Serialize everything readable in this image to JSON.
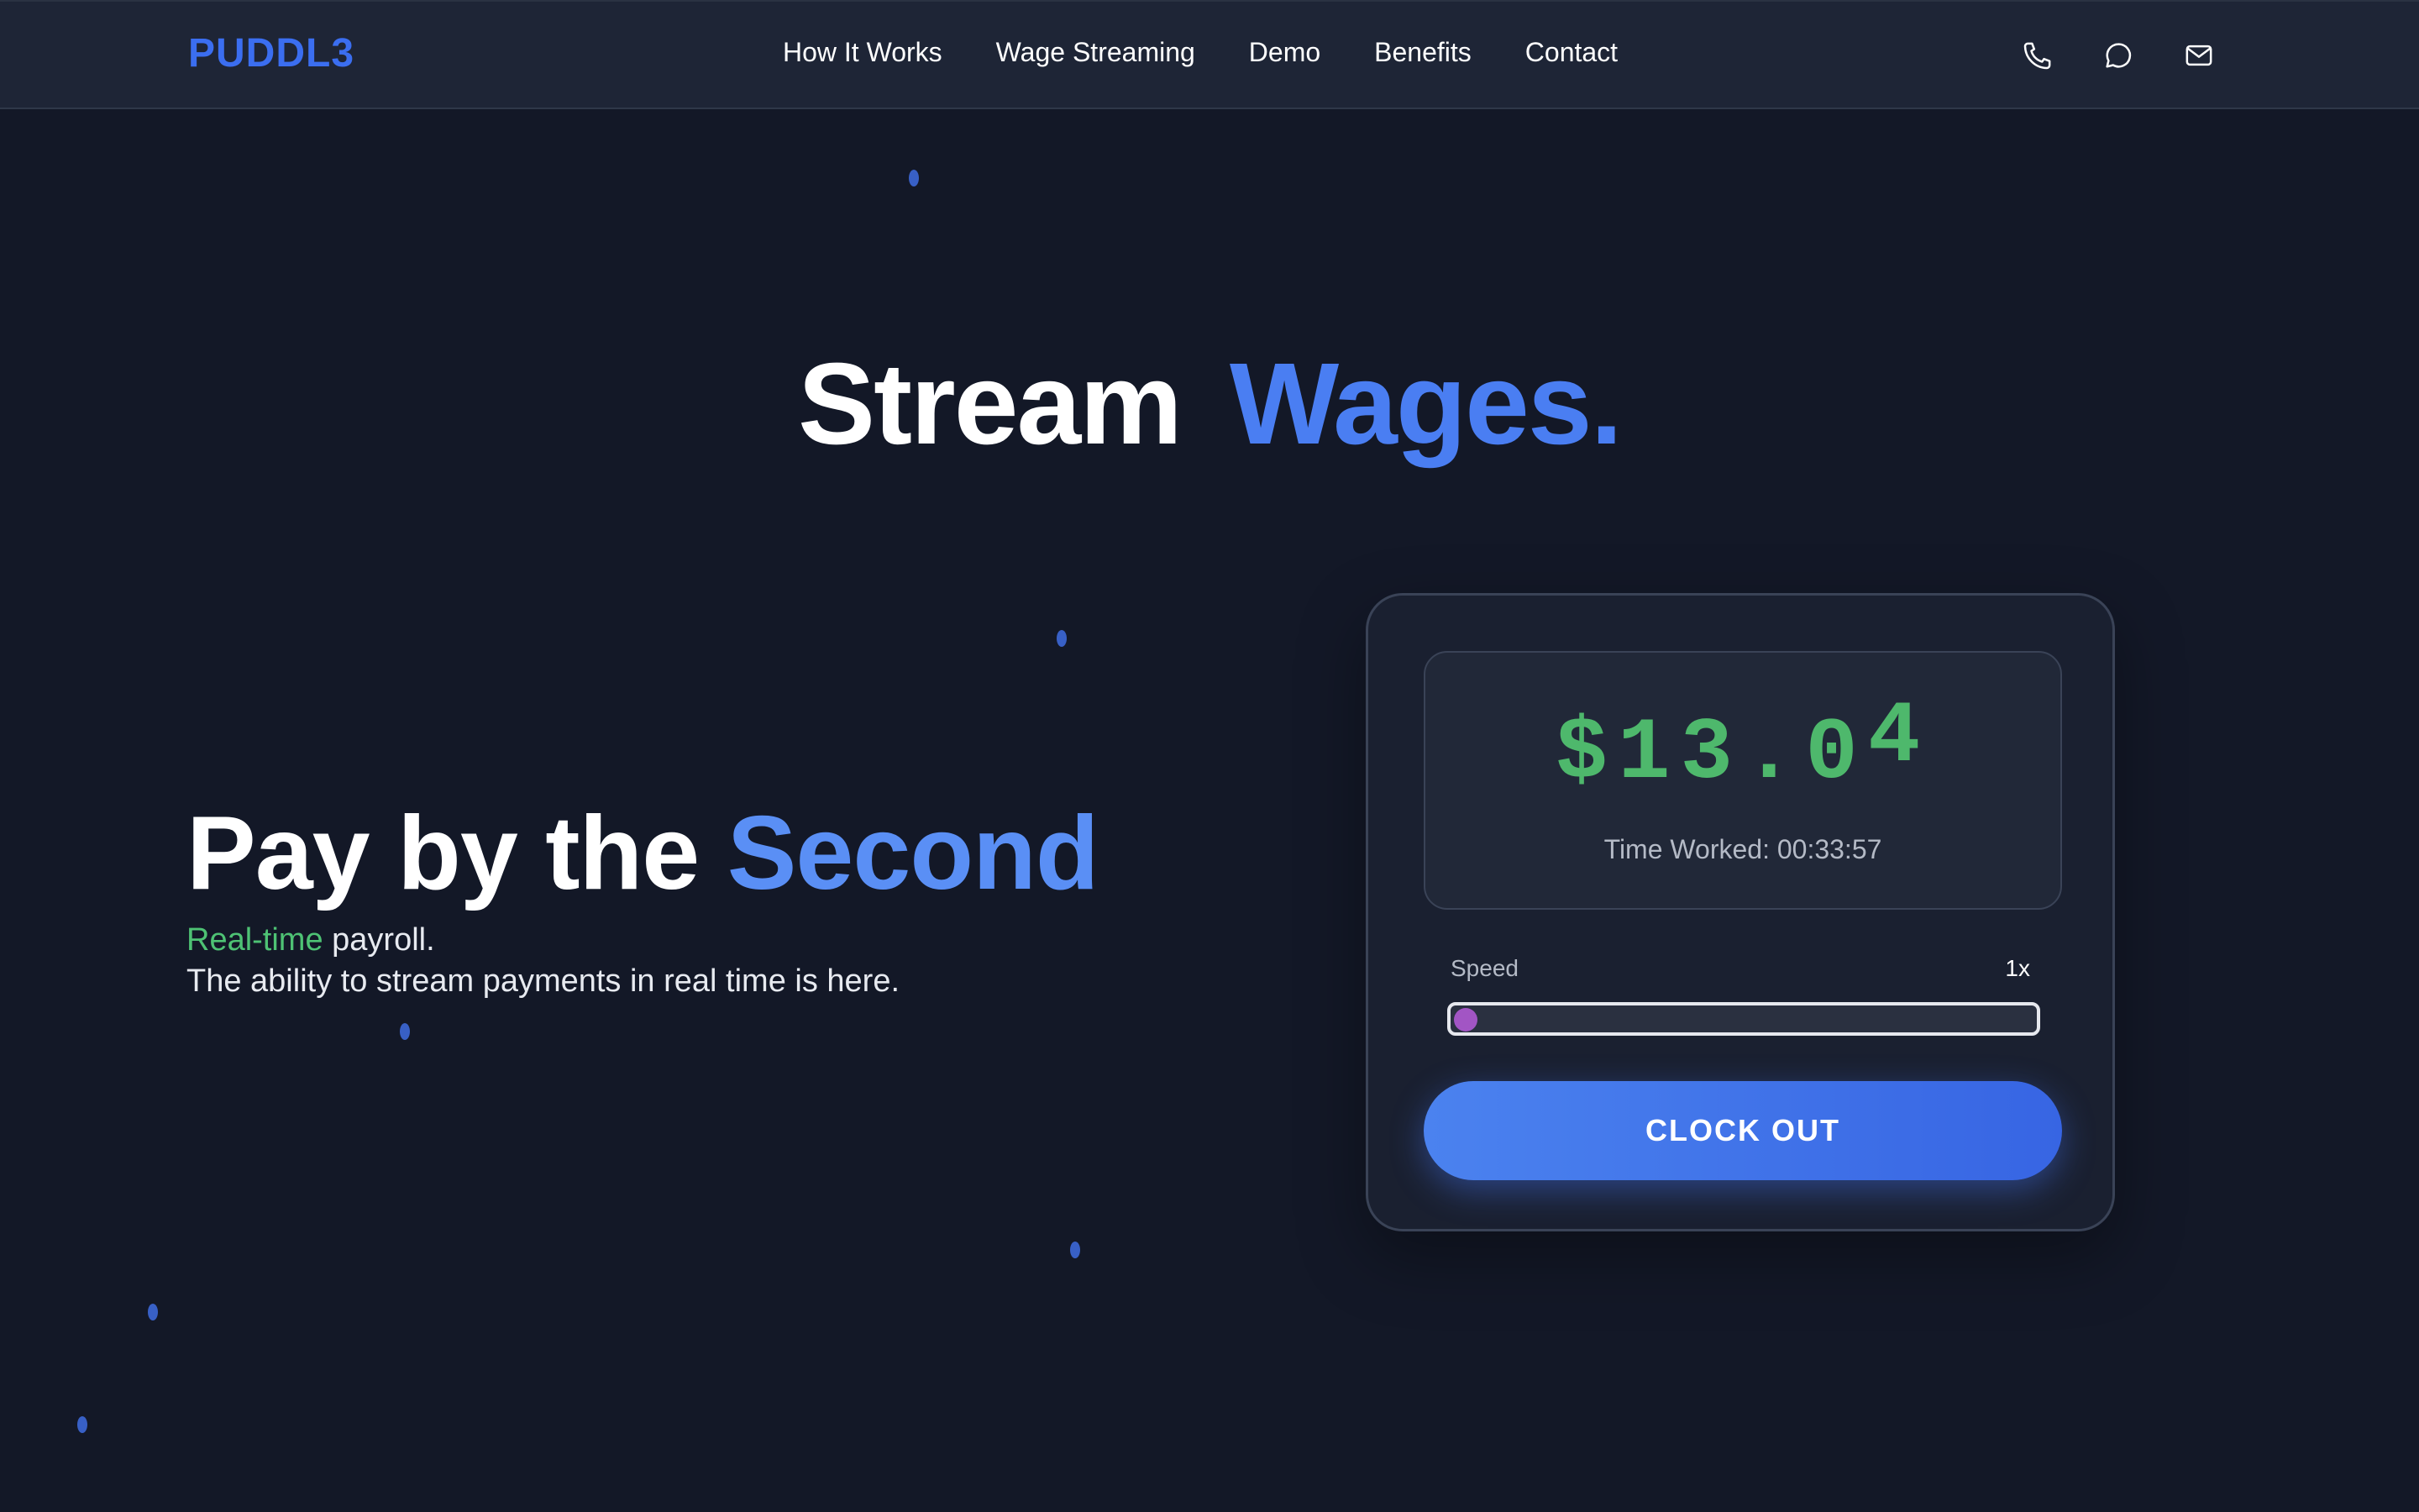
{
  "nav": {
    "logo": "PUDDL3",
    "links": [
      "How It Works",
      "Wage Streaming",
      "Demo",
      "Benefits",
      "Contact"
    ],
    "icons": [
      "phone-icon",
      "chat-icon",
      "mail-icon"
    ]
  },
  "hero": {
    "title_part1": "Stream",
    "title_part2": "Wages."
  },
  "pitch": {
    "title_part1": "Pay by the ",
    "title_part2": "Second",
    "sub_highlight": "Real-time",
    "sub_rest": " payroll.",
    "sub_line2": "The ability to stream payments in real time is here."
  },
  "widget": {
    "amount_main": "$13.0",
    "amount_last": "4",
    "time_worked": "Time Worked: 00:33:57",
    "speed_label": "Speed",
    "speed_value": "1x",
    "speed_fraction": 0,
    "button_label": "CLOCK OUT"
  },
  "colors": {
    "background": "#131827",
    "accent_blue": "#4a7ef2",
    "money_green": "#4eb86c",
    "slider_thumb": "#a255c4"
  }
}
